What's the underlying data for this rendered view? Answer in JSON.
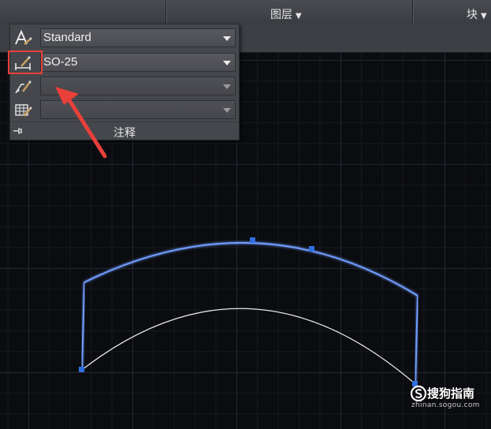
{
  "ribbon": {
    "layers_label": "图层",
    "block_label": "块"
  },
  "annotation_panel": {
    "text_style": {
      "value": "Standard",
      "icon": "text-style-icon"
    },
    "dimension_style": {
      "value": "SO-25",
      "icon": "dimension-style-icon"
    },
    "multileader_style": {
      "value": "",
      "icon": "multileader-style-icon"
    },
    "table_style": {
      "value": "",
      "icon": "table-style-icon"
    },
    "footer_label": "注释",
    "pin_icon": "pin-icon"
  },
  "callout": {
    "highlight_color": "#e8403a",
    "arrow_color": "#e8403a"
  },
  "drawing": {
    "selected_outline_color": "#5a8cff",
    "arc_color": "#e8e8e8",
    "grip_color": "#2f6fe0"
  },
  "watermark": {
    "brand": "搜狗指南",
    "url": "zhinan.sogou.com"
  }
}
